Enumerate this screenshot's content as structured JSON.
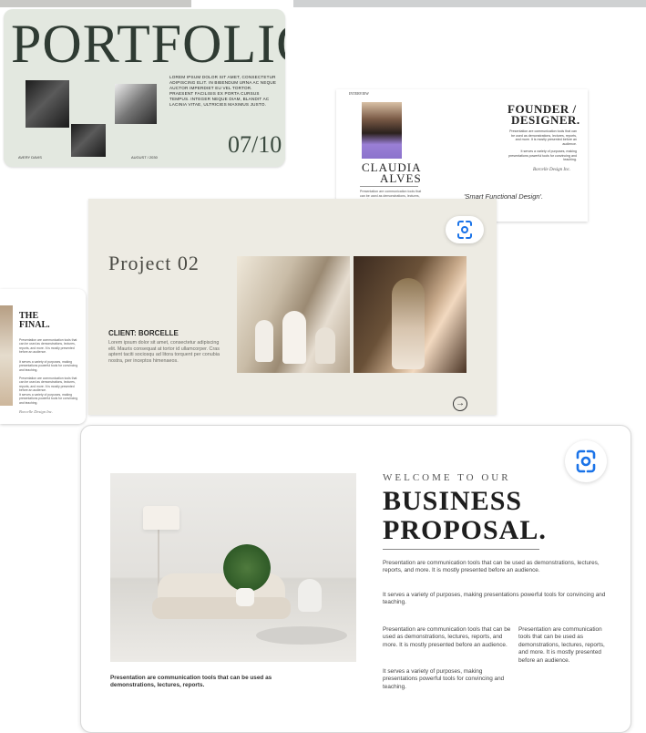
{
  "portfolio": {
    "title": "PORTFOLIO",
    "body": "Lorem ipsum dolor sit amet, consectetur adipiscing elit. In bibendum urna ac neque auctor imperdiet eu vel tortor. Praesent facilisis ex porta cursus tempus. Integer neque diam, blandit ac lacinia vitae, ultricies maximus justo.",
    "name": "Avery Davis",
    "date": "August / 2030",
    "page": "07/10"
  },
  "founder": {
    "interview": "Interview",
    "first_name": "CLAUDIA",
    "last_name": "ALVES",
    "description": "Presentation are communication tools that can be used as demonstrations, lectures, reports.",
    "heading_line1": "FOUNDER /",
    "heading_line2": "DESIGNER.",
    "paragraph1": "Presentation are communication tools that can be used as demonstrations, lectures, reports, and more. It is mostly presented before an audience.",
    "paragraph2": "It serves a variety of purposes, making presentations powerful tools for convincing and teaching.",
    "signature": "Borcelle Design Inc.",
    "quote": "'Smart Functional Design'."
  },
  "project": {
    "title": "Project 02",
    "client": "CLIENT: BORCELLE",
    "body": "Lorem ipsum dolor sit amet, consectetur adipiscing elit. Mauris consequat at tortor id ullamcorper. Cras aptent taciti sociosqu ad litora torquent per conubia nostra, per inceptos himenaeos.",
    "arrow_icon": "arrow-right-circle-icon"
  },
  "final": {
    "title_line1": "THE",
    "title_line2": "FINAL.",
    "p1": "Presentation are communication tools that can be used as demonstrations, lectures, reports, and more. It is mostly presented before an audience.",
    "p2": "It serves a variety of purposes, making presentations powerful tools for convincing and teaching.",
    "p3": "Presentation are communication tools that can be used as demonstrations, lectures, reports, and more. It is mostly presented before an audience.",
    "p4": "It serves a variety of purposes, making presentations powerful tools for convincing and teaching.",
    "signature": "Borcelle Design Inc."
  },
  "business": {
    "welcome": "WELCOME TO OUR",
    "title_line1": "BUSINESS",
    "title_line2": "PROPOSAL.",
    "p1": "Presentation are communication tools that can be used as demonstrations, lectures, reports, and more. It is mostly presented before an audience.",
    "p2": "It serves a variety of purposes, making presentations powerful tools for convincing and teaching.",
    "col1a": "Presentation are communication tools that can be used as demonstrations, lectures, reports, and more. It is mostly presented before an audience.",
    "col1b": "It serves a variety of purposes, making presentations powerful tools for convincing and teaching.",
    "col2": "Presentation are communication tools that can be used as demonstrations, lectures, reports, and more. It is mostly presented before an audience.",
    "caption": "Presentation are communication tools that can be used as demonstrations, lectures, reports."
  },
  "icons": {
    "scan": "lens-scan-icon"
  },
  "colors": {
    "lens_blue": "#1a73e8",
    "portfolio_bg": "#e3e8e0",
    "project_bg": "#edebe3"
  }
}
